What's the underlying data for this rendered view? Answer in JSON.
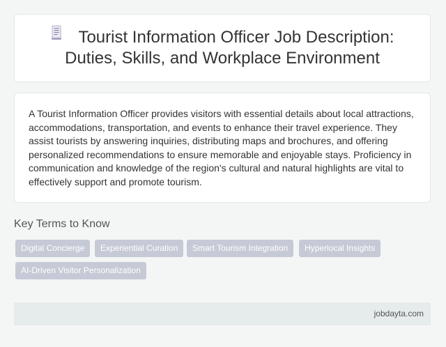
{
  "header": {
    "icon": "document-icon",
    "title": "Tourist Information Officer Job Description: Duties, Skills, and Workplace Environment"
  },
  "summary": {
    "text": "A Tourist Information Officer provides visitors with essential details about local attractions, accommodations, transportation, and events to enhance their travel experience. They assist tourists by answering inquiries, distributing maps and brochures, and offering personalized recommendations to ensure memorable and enjoyable stays. Proficiency in communication and knowledge of the region's cultural and natural highlights are vital to effectively support and promote tourism."
  },
  "key_terms": {
    "heading": "Key Terms to Know",
    "tags": [
      "Digital Concierge",
      "Experiential Curation",
      "Smart Tourism Integration",
      "Hyperlocal Insights",
      "AI-Driven Visitor Personalization"
    ]
  },
  "footer": {
    "site": "jobdayta.com"
  },
  "colors": {
    "page_background": "#f4f6f6",
    "card_background": "#ffffff",
    "tag_background": "#c6cad6",
    "footer_background": "#e6ebeb"
  }
}
